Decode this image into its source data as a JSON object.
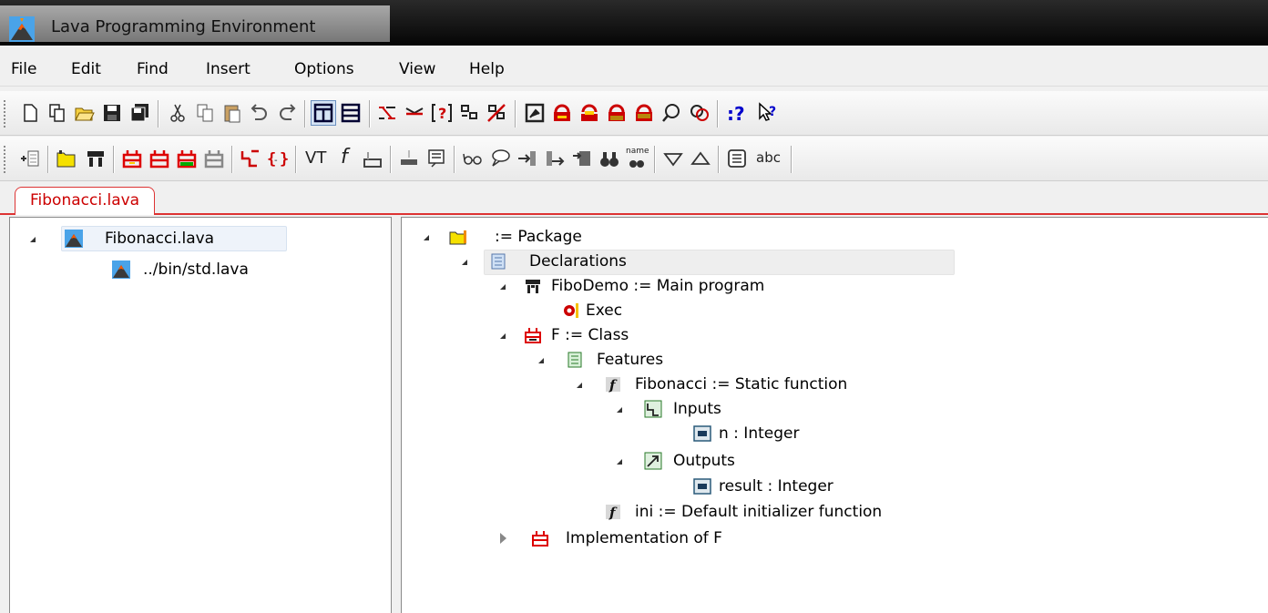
{
  "window": {
    "title": "Lava Programming Environment",
    "icon": "lava-volcano-icon"
  },
  "menu": [
    "File",
    "Edit",
    "Find",
    "Insert",
    "Options",
    "View",
    "Help"
  ],
  "toolbar1_icons": [
    "new-document-icon",
    "copy-document-icon",
    "open-folder-icon",
    "save-icon",
    "save-all-icon",
    "cut-icon",
    "copy-icon",
    "paste-icon",
    "undo-icon",
    "redo-icon",
    "split-vertical-icon",
    "split-horizontal-icon",
    "declaration-icon",
    "jump-icon",
    "help-bracket-icon",
    "tree-icon",
    "error-tree-icon",
    "frame-icon",
    "lock-yellow-icon",
    "unlock-yellow-icon",
    "error-red-icon",
    "error-red-alt-icon",
    "search-icon",
    "find-all-icon",
    "whats-this-icon",
    "help-pointer-icon"
  ],
  "toolbar2_icons": [
    "insert-line-icon",
    "package-icon",
    "main-program-icon",
    "class-red-icon",
    "class-red-alt-icon",
    "class-green-icon",
    "class-gray-icon",
    "inputs-icon",
    "braces-icon",
    "vt-text-icon",
    "function-icon",
    "initializer-icon",
    "member-gray-icon",
    "comment-icon",
    "glasses-icon",
    "speech-icon",
    "arrow-in-icon",
    "arrow-out-icon",
    "document-arrow-icon",
    "binoculars-icon",
    "name-binoculars-icon",
    "triangle-down-icon",
    "triangle-up-icon",
    "keyboard-icon",
    "abc-text-icon"
  ],
  "toolbar2_texts": {
    "vt": "VT",
    "f": "f",
    "abc": "abc",
    "name": "name"
  },
  "file_tab": "Fibonacci.lava",
  "left_tree": [
    {
      "label": "Fibonacci.lava",
      "expanded": true,
      "selected": true
    },
    {
      "label": "../bin/std.lava"
    }
  ],
  "right_tree": [
    {
      "label": ":= Package",
      "icon": "package-folder-icon",
      "state": "open"
    },
    {
      "label": "Declarations",
      "icon": "declarations-icon",
      "state": "open"
    },
    {
      "label": "FiboDemo := Main program",
      "icon": "main-program-icon",
      "state": "open"
    },
    {
      "label": "Exec",
      "icon": "exec-gear-icon",
      "state": "none"
    },
    {
      "label": "F := Class",
      "icon": "class-icon",
      "state": "open"
    },
    {
      "label": "Features",
      "icon": "features-icon",
      "state": "open"
    },
    {
      "label": "Fibonacci := Static function",
      "icon": "function-icon",
      "state": "open"
    },
    {
      "label": "Inputs",
      "icon": "inputs-icon",
      "state": "open"
    },
    {
      "label": "n : Integer",
      "icon": "variable-icon",
      "state": "none"
    },
    {
      "label": "Outputs",
      "icon": "outputs-icon",
      "state": "open"
    },
    {
      "label": "result : Integer",
      "icon": "variable-icon",
      "state": "none"
    },
    {
      "label": "ini := Default initializer function",
      "icon": "function-icon",
      "state": "none"
    },
    {
      "label": "Implementation of F",
      "icon": "class-icon",
      "state": "closed"
    }
  ]
}
